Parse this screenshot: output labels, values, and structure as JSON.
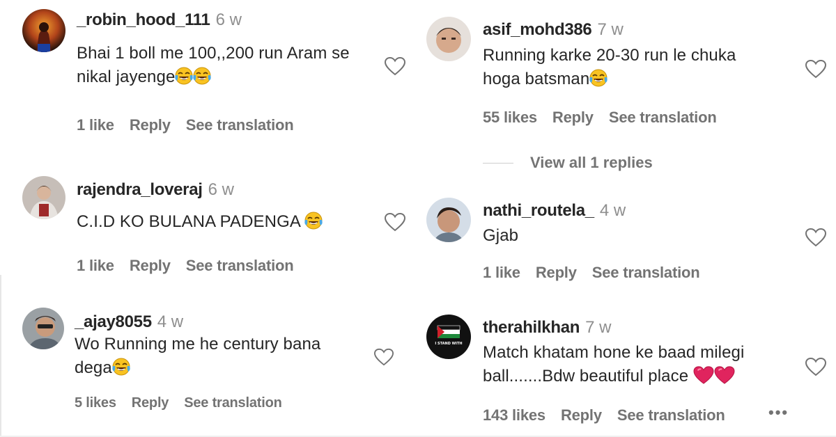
{
  "comments": [
    {
      "username": "_robin_hood_111",
      "time": "6 w",
      "line1": "Bhai 1 boll me 100,,200 run Aram se",
      "line2": "nikal jayenge",
      "likes": "1 like",
      "reply": "Reply",
      "translate": "See translation",
      "avatar_colors": [
        "#2c1a12",
        "#c0571c"
      ]
    },
    {
      "username": "rajendra_loveraj",
      "time": "6 w",
      "line1": "C.I.D KO BULANA PADENGA",
      "likes": "1 like",
      "reply": "Reply",
      "translate": "See translation",
      "avatar_colors": [
        "#b8b1ad",
        "#6d5a4e"
      ]
    },
    {
      "username": "_ajay8055",
      "time": "4 w",
      "line1": "Wo Running me he century bana",
      "line2": "dega",
      "likes": "5 likes",
      "reply": "Reply",
      "translate": "See translation",
      "avatar_colors": [
        "#8a8d8f",
        "#c49a7b"
      ]
    },
    {
      "username": "asif_mohd386",
      "time": "7 w",
      "line1": "Running karke 20-30 run le chuka",
      "line2": "hoga batsman",
      "likes": "55 likes",
      "reply": "Reply",
      "translate": "See translation",
      "view_replies": "View all 1 replies",
      "avatar_colors": [
        "#e8e2dd",
        "#c79c82"
      ]
    },
    {
      "username": "nathi_routela_",
      "time": "4 w",
      "line1": "Gjab",
      "likes": "1 like",
      "reply": "Reply",
      "translate": "See translation",
      "avatar_colors": [
        "#cfd8e3",
        "#8a6650"
      ]
    },
    {
      "username": "therahilkhan",
      "time": "7 w",
      "line1": "Match khatam hone ke baad milegi",
      "line2": "ball.......Bdw beautiful place",
      "likes": "143 likes",
      "reply": "Reply",
      "translate": "See translation",
      "more": "•••",
      "avatar_badge": "I STAND WITH",
      "avatar_colors": [
        "#111111",
        "#1f8a3b"
      ]
    }
  ],
  "icons": {
    "heart": "heart-outline-icon",
    "laugh_emoji": "face-with-tears-of-joy-emoji",
    "red_heart": "red-heart-emoji"
  },
  "colors": {
    "text": "#262626",
    "secondary": "#737373",
    "heart_red": "#e0245e"
  }
}
